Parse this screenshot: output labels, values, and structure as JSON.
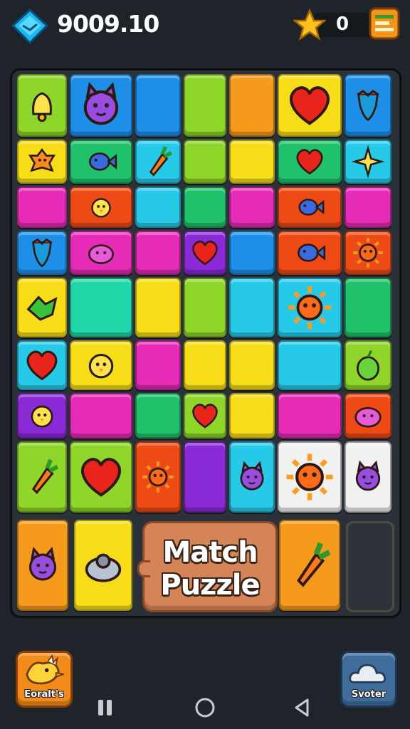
{
  "header": {
    "coin_balance": "9009.10",
    "star_count": "0",
    "icons": {
      "currency": "gem-icon",
      "stars": "star-icon",
      "menu": "menu-icon"
    }
  },
  "board": {
    "title_line1": "Match",
    "title_line2": "Puzzle",
    "colors": {
      "lime": "#8fd52a",
      "blue": "#1e8fe8",
      "orange": "#f59a1a",
      "yellow": "#f6dd18",
      "cyan": "#27c9e8",
      "green": "#1fc26a",
      "magenta": "#e62bb6",
      "red": "#ee4a16",
      "purple": "#8a2ad6",
      "teal": "#20d6a6",
      "white": "#f1f1f1"
    }
  },
  "footer": {
    "left_button_label": "Eoralt's",
    "right_button_label": "Svoter",
    "left_button_icon": "bird-icon",
    "right_button_icon": "cloud-icon"
  },
  "system_nav": {
    "recents": "recents-icon",
    "home": "home-icon",
    "back": "back-icon"
  }
}
